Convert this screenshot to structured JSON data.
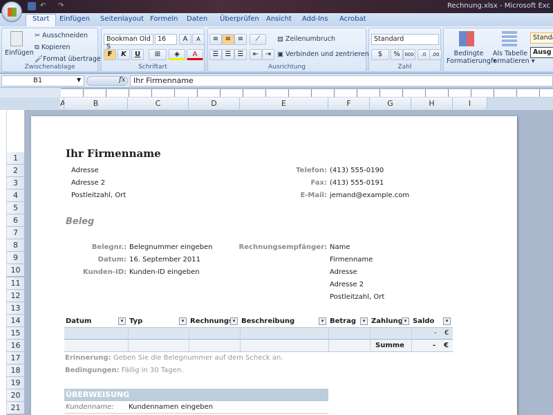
{
  "window": {
    "title": "Rechnung.xlsx - Microsoft Exc"
  },
  "tabs": [
    "Start",
    "Einfügen",
    "Seitenlayout",
    "Formeln",
    "Daten",
    "Überprüfen",
    "Ansicht",
    "Add-Ins",
    "Acrobat"
  ],
  "clipboard": {
    "paste": "Einfügen",
    "cut": "Ausschneiden",
    "copy": "Kopieren",
    "format": "Format übertragen",
    "label": "Zwischenablage"
  },
  "font": {
    "name": "Bookman Old S",
    "size": "16",
    "bold": "F",
    "italic": "K",
    "underline": "U",
    "label": "Schriftart"
  },
  "alignment": {
    "wrap": "Zeilenumbruch",
    "merge": "Verbinden und zentrieren",
    "label": "Ausrichtung"
  },
  "number": {
    "format": "Standard",
    "percent": "%",
    "thousands": "000",
    "label": "Zahl"
  },
  "styles": {
    "conditional1": "Bedingte",
    "conditional2": "Formatierung",
    "table1": "Als Tabelle",
    "table2": "formatieren",
    "style1": "Standa",
    "style2": "Ausg"
  },
  "formula_bar": {
    "cell": "B1",
    "fx": "fx",
    "value": "Ihr Firmenname"
  },
  "columns": [
    "A",
    "B",
    "C",
    "D",
    "E",
    "F",
    "G",
    "H",
    "I"
  ],
  "rows": [
    "1",
    "2",
    "3",
    "4",
    "5",
    "6",
    "7",
    "8",
    "9",
    "10",
    "11",
    "12",
    "13",
    "14",
    "15",
    "16",
    "17",
    "18",
    "19",
    "20",
    "21"
  ],
  "doc": {
    "company": "Ihr Firmenname",
    "addr1": "Adresse",
    "addr2": "Adresse 2",
    "addr3": "Postleitzahl, Ort",
    "phone_l": "Telefon:",
    "phone": "(413) 555-0190",
    "fax_l": "Fax:",
    "fax": "(413) 555-0191",
    "mail_l": "E-Mail:",
    "mail": "jemand@example.com",
    "beleg": "Beleg",
    "belegnr_l": "Belegnr.:",
    "belegnr": "Belegnummer eingeben",
    "datum_l": "Datum:",
    "datum": "16. September 2011",
    "kunden_l": "Kunden-ID:",
    "kunden": "Kunden-ID eingeben",
    "empf_l": "Rechnungsempfänger:",
    "empf": [
      "Name",
      "Firmenname",
      "Adresse",
      "Adresse 2",
      "Postleitzahl, Ort"
    ],
    "table_headers": [
      "Datum",
      "Typ",
      "Rechnungsn",
      "Beschreibung",
      "Betrag",
      "Zahlung",
      "Saldo"
    ],
    "row_dash": "-",
    "currency": "€",
    "summe": "Summe",
    "erinnerung_l": "Erinnerung:",
    "erinnerung": "Geben Sie die Belegnummer auf dem Scheck an.",
    "bed_l": "Bedingungen:",
    "bed": "Fällig in 30 Tagen.",
    "ueberweisung": "ÜBERWEISUNG",
    "kundenname_l": "Kundenname:",
    "kundenname": "Kundennamen eingeben"
  }
}
